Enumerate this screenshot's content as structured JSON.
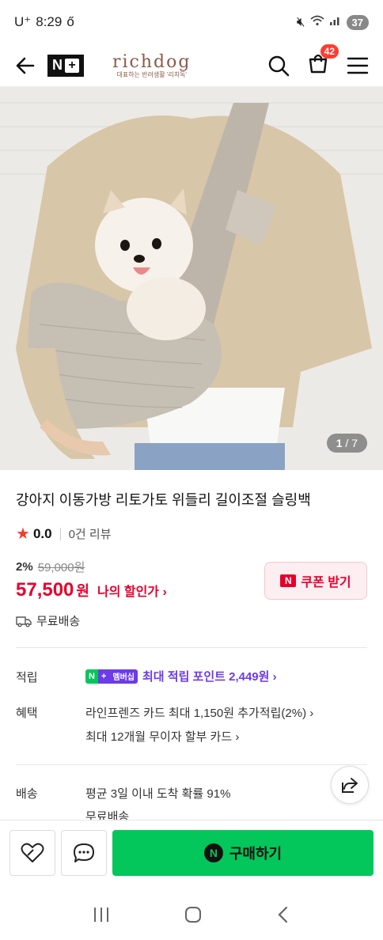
{
  "status": {
    "carrier": "U⁺",
    "time": "8:29",
    "battery": "37"
  },
  "header": {
    "brand_name": "richdog",
    "brand_sub": "대표하는 반려생활 '리치독'",
    "nplus_label": "N",
    "cart_count": "42"
  },
  "gallery": {
    "counter_current": "1",
    "counter_total": "/ 7"
  },
  "product": {
    "title": "강아지 이동가방 리토가토 위들리 길이조절 슬링백",
    "rating": "0.0",
    "reviews": "0건 리뷰",
    "discount_pct": "2%",
    "original_price": "59,000원",
    "price": "57,500",
    "price_unit": "원",
    "my_discount": "나의 할인가 ›",
    "coupon_label": "쿠폰 받기",
    "shipping": "무료배송"
  },
  "points": {
    "label": "적립",
    "badge_n": "N",
    "badge_plus": "+",
    "badge_member": "멤버십",
    "text": "최대 적립 포인트 2,449원 ›"
  },
  "benefits": {
    "label": "혜택",
    "line1": "라인프렌즈 카드 최대 1,150원 추가적립(2%) ›",
    "line2": "최대 12개월 무이자 할부 카드 ›"
  },
  "delivery": {
    "label": "배송",
    "line1": "평균 3일 이내 도착 확률 91%",
    "line2": "무료배송"
  },
  "bottom": {
    "buy_label": "구매하기",
    "buy_n": "N"
  },
  "colors": {
    "accent_red": "#e6002d",
    "naver_green": "#03c75a",
    "membership_purple": "#6d3be8"
  }
}
